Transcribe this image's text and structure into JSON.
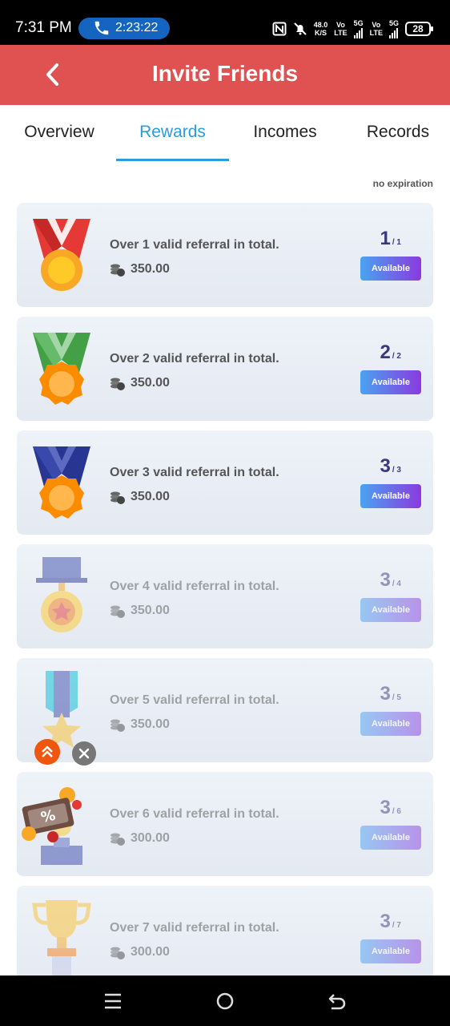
{
  "status_bar": {
    "time": "7:31 PM",
    "call_duration": "2:23:22",
    "net_speed_value": "48.0",
    "net_speed_unit": "K/S",
    "sim1_top": "Vo",
    "sim1_bottom": "LTE",
    "sim1_net": "5G",
    "sim2_top": "Vo",
    "sim2_bottom": "LTE",
    "sim2_net": "5G",
    "battery": "28"
  },
  "header": {
    "title": "Invite Friends"
  },
  "tabs": [
    {
      "label": "Overview"
    },
    {
      "label": "Rewards"
    },
    {
      "label": "Incomes"
    },
    {
      "label": "Records"
    }
  ],
  "active_tab": "Rewards",
  "expiry_note": "no expiration",
  "rewards": [
    {
      "description": "Over 1 valid referral in total.",
      "amount": "350.00",
      "current": "1",
      "target": "/ 1",
      "button": "Available",
      "medal": "red-ribbon-medal-icon"
    },
    {
      "description": "Over 2 valid referral in total.",
      "amount": "350.00",
      "current": "2",
      "target": "/ 2",
      "button": "Available",
      "medal": "green-ribbon-medal-icon"
    },
    {
      "description": "Over 3 valid referral in total.",
      "amount": "350.00",
      "current": "3",
      "target": "/ 3",
      "button": "Available",
      "medal": "blue-ribbon-medal-icon"
    },
    {
      "description": "Over 4 valid referral in total.",
      "amount": "350.00",
      "current": "3",
      "target": "/ 4",
      "button": "Available",
      "medal": "badge-medal-icon"
    },
    {
      "description": "Over 5 valid referral in total.",
      "amount": "350.00",
      "current": "3",
      "target": "/ 5",
      "button": "Available",
      "medal": "star-medal-icon"
    },
    {
      "description": "Over 6 valid referral in total.",
      "amount": "300.00",
      "current": "3",
      "target": "/ 6",
      "button": "Available",
      "medal": "podium-icon"
    },
    {
      "description": "Over 7 valid referral in total.",
      "amount": "300.00",
      "current": "3",
      "target": "/ 7",
      "button": "Available",
      "medal": "trophy-icon"
    }
  ],
  "colors": {
    "header_bg": "#e05151",
    "tab_active": "#2a9ce0",
    "button_gradient_start": "#4aa3f0",
    "button_gradient_end": "#8a3ae0",
    "progress_text": "#3a3a7a"
  }
}
